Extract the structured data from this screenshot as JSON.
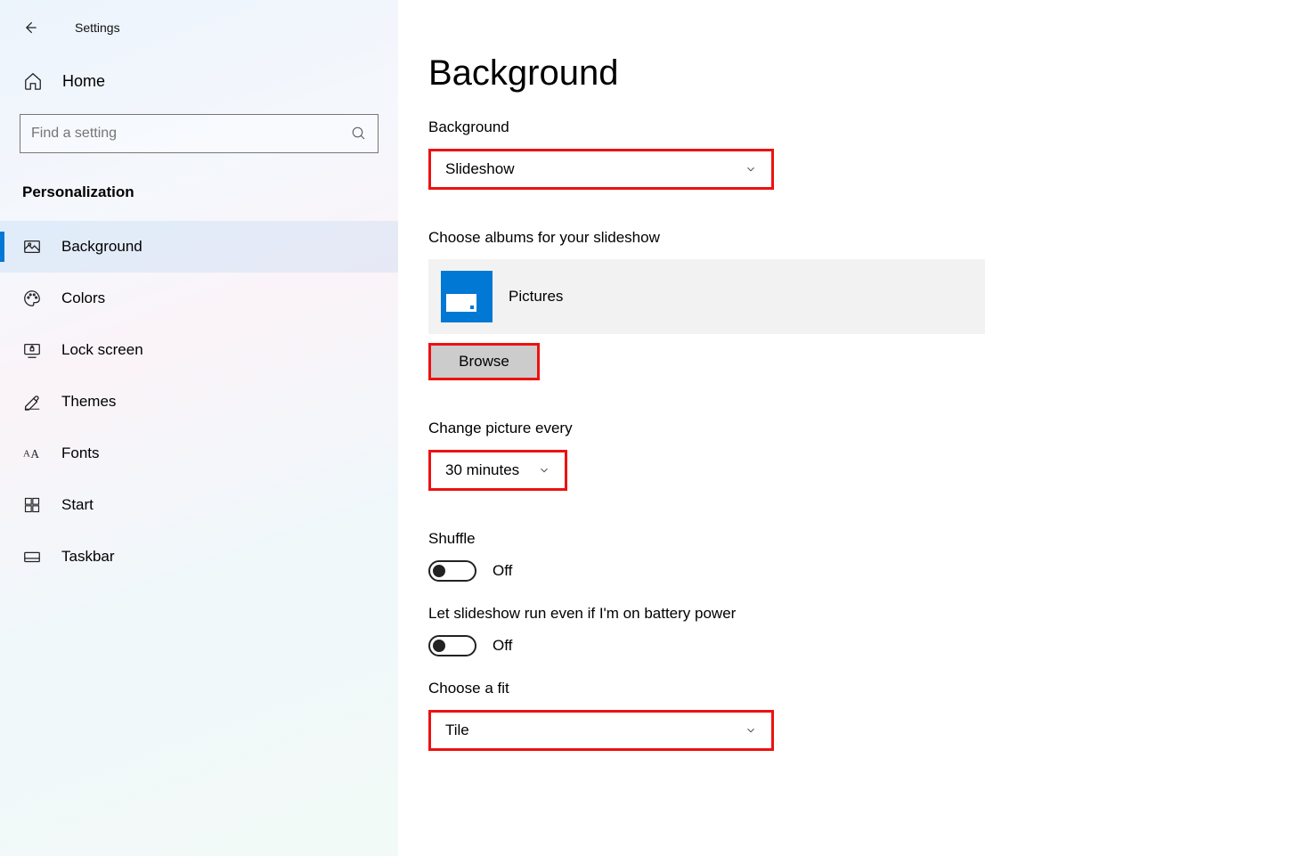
{
  "app_title": "Settings",
  "home_label": "Home",
  "search_placeholder": "Find a setting",
  "section_title": "Personalization",
  "nav": [
    {
      "label": "Background",
      "icon": "picture"
    },
    {
      "label": "Colors",
      "icon": "palette"
    },
    {
      "label": "Lock screen",
      "icon": "lock-screen"
    },
    {
      "label": "Themes",
      "icon": "themes"
    },
    {
      "label": "Fonts",
      "icon": "fonts"
    },
    {
      "label": "Start",
      "icon": "start"
    },
    {
      "label": "Taskbar",
      "icon": "taskbar"
    }
  ],
  "page": {
    "title": "Background",
    "bg_label": "Background",
    "bg_value": "Slideshow",
    "albums_label": "Choose albums for your slideshow",
    "album_name": "Pictures",
    "browse_label": "Browse",
    "interval_label": "Change picture every",
    "interval_value": "30 minutes",
    "shuffle_label": "Shuffle",
    "shuffle_state": "Off",
    "battery_label": "Let slideshow run even if I'm on battery power",
    "battery_state": "Off",
    "fit_label": "Choose a fit",
    "fit_value": "Tile"
  }
}
